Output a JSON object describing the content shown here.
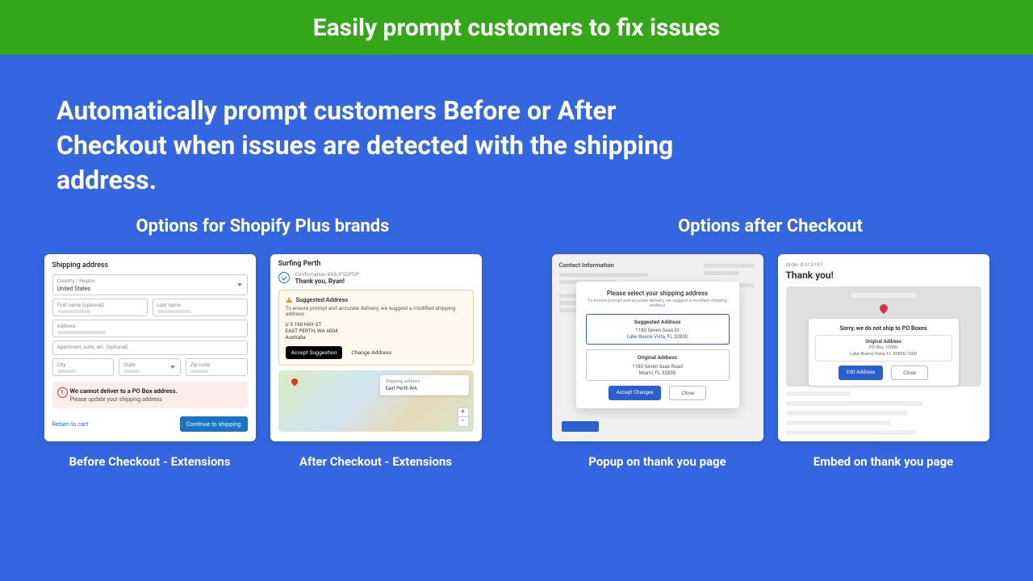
{
  "banner": {
    "title": "Easily prompt customers to fix issues"
  },
  "headline": "Automatically prompt customers Before or After Checkout when issues are detected with the shipping address.",
  "left": {
    "title": "Options for Shopify Plus brands",
    "card1": {
      "caption": "Before Checkout - Extensions",
      "section_title": "Shipping address",
      "country_label": "Country / Region",
      "country_value": "United States",
      "first_name": "First name (optional)",
      "last_name": "Last name",
      "address": "Address",
      "apt": "Apartment, suite, etc. (optional)",
      "city": "City",
      "state": "State",
      "zip": "Zip code",
      "warn_title": "We cannot deliver to a PO Box address.",
      "warn_sub": "Please update your shipping address",
      "return": "Return to cart",
      "continue": "Continue to shipping"
    },
    "card2": {
      "caption": "After Checkout - Extensions",
      "store": "Surfing Perth",
      "confirmation": "Confirmation #X8JFSDPDP",
      "thankyou": "Thank you, Ryan!",
      "sug_title": "Suggested Address",
      "sug_desc": "To ensure prompt and accurate delivery, we suggest a modified shipping address",
      "addr_l1": "U 5 190 HAY ST",
      "addr_l2": "EAST PERTH, WA 6004",
      "addr_l3": "Australia",
      "accept": "Accept Suggestion",
      "change": "Change Address",
      "map_ship_label": "Shipping address",
      "map_ship_value": "East Perth WA"
    }
  },
  "right": {
    "title": "Options after Checkout",
    "card1": {
      "caption": "Popup on thank you page",
      "contact": "Contact Information",
      "modal_title": "Please select your shipping address",
      "modal_sub": "To ensure prompt and accurate delivery, we suggest a modified shipping address",
      "sug_h": "Suggested Address",
      "sug_l1": "1180 Seven Seas Dr",
      "sug_l2_a": "Lake Buena Vista",
      "sug_l2_b": ", FL 32830",
      "orig_h": "Original Address",
      "orig_l1": "1180 Seven Seas Road",
      "orig_l2": "Miami, FL 32830",
      "accept": "Accept Changes",
      "close": "Close"
    },
    "card2": {
      "caption": "Embed on thank you page",
      "order": "Order # 015197",
      "thankyou": "Thank you!",
      "warn": "Sorry, we do not ship to PO Boxes",
      "orig_h": "Original Address",
      "orig_l1": "PO Box 10000",
      "orig_l2": "Lake Buena Vista, FL 32830-1000",
      "edit": "Edit Address",
      "close": "Close"
    }
  }
}
